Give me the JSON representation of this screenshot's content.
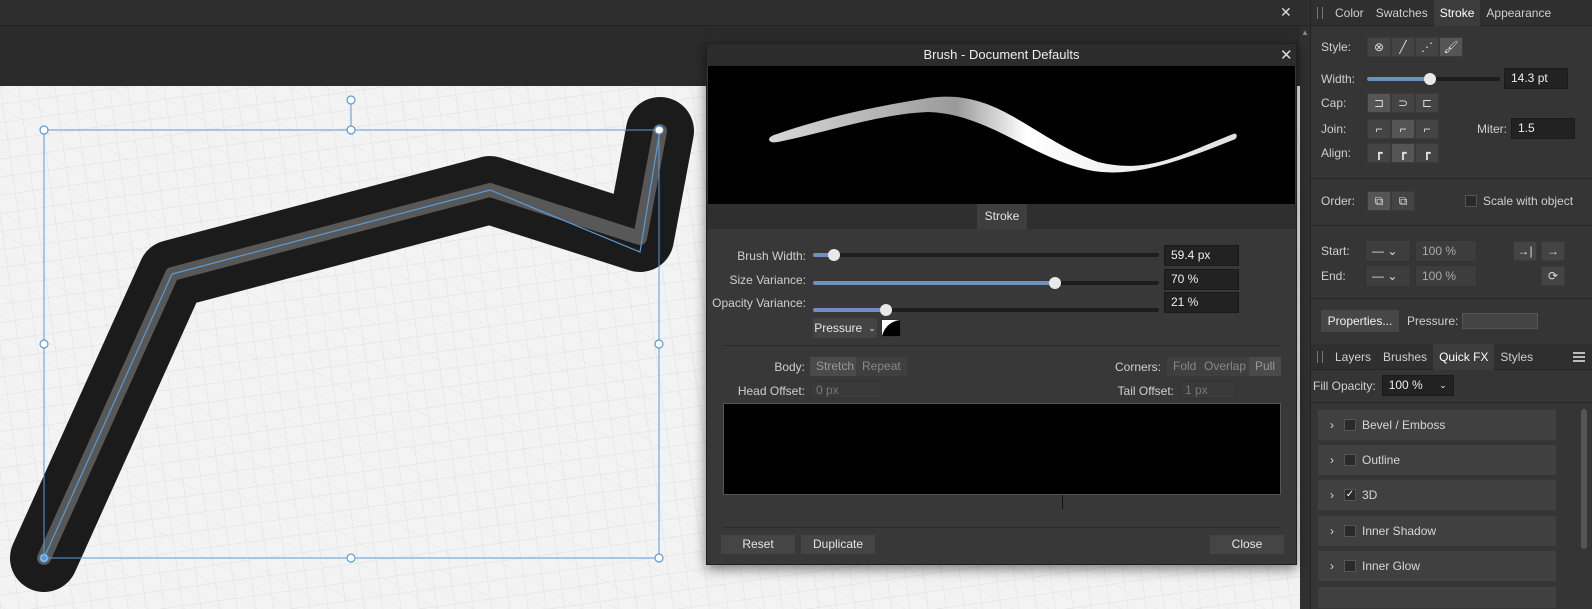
{
  "dialog": {
    "title": "Brush - Document Defaults",
    "tab": "Stroke",
    "brush_width": {
      "label": "Brush Width:",
      "value": "59.4 px",
      "fraction": 0.06
    },
    "size_variance": {
      "label": "Size Variance:",
      "value": "70 %",
      "fraction": 0.7
    },
    "opacity_variance": {
      "label": "Opacity Variance:",
      "value": "21 %",
      "fraction": 0.21
    },
    "pressure_label": "Pressure",
    "body_label": "Body:",
    "body_options": [
      "Stretch",
      "Repeat"
    ],
    "corners_label": "Corners:",
    "corners_options": [
      "Fold",
      "Overlap",
      "Pull"
    ],
    "head_offset_label": "Head Offset:",
    "head_offset_value": "0 px",
    "tail_offset_label": "Tail Offset:",
    "tail_offset_value": "1 px",
    "buttons": {
      "reset": "Reset",
      "duplicate": "Duplicate",
      "close": "Close"
    }
  },
  "top_panel": {
    "tabs": [
      "Color",
      "Swatches",
      "Stroke",
      "Appearance"
    ],
    "active_tab": "Stroke",
    "style_label": "Style:",
    "width_label": "Width:",
    "width_value": "14.3 pt",
    "width_fraction": 0.47,
    "cap_label": "Cap:",
    "join_label": "Join:",
    "miter_label": "Miter:",
    "miter_value": "1.5",
    "align_label": "Align:",
    "order_label": "Order:",
    "scale_label": "Scale with object",
    "start_label": "Start:",
    "end_label": "End:",
    "start_pct": "100 %",
    "end_pct": "100 %",
    "properties_button": "Properties...",
    "pressure_label": "Pressure:"
  },
  "bottom_panel": {
    "tabs": [
      "Layers",
      "Brushes",
      "Quick FX",
      "Styles"
    ],
    "active_tab": "Quick FX",
    "fill_opacity_label": "Fill Opacity:",
    "fill_opacity_value": "100 %",
    "effects": [
      {
        "name": "Bevel / Emboss",
        "checked": false
      },
      {
        "name": "Outline",
        "checked": false
      },
      {
        "name": "3D",
        "checked": true
      },
      {
        "name": "Inner Shadow",
        "checked": false
      },
      {
        "name": "Inner Glow",
        "checked": false
      }
    ]
  },
  "colors": {
    "accent": "#6e8fc0",
    "selection": "#5b9bd5"
  }
}
